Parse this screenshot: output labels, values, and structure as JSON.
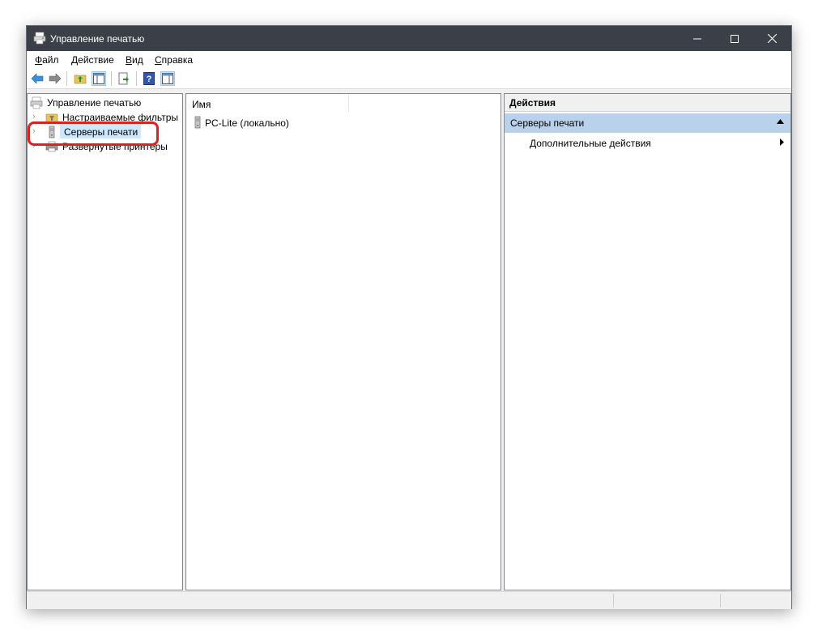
{
  "window": {
    "title": "Управление печатью"
  },
  "menu": {
    "file": {
      "key": "Ф",
      "rest": "айл"
    },
    "action": {
      "key": "Д",
      "rest": "ействие"
    },
    "view": {
      "key": "В",
      "rest": "ид"
    },
    "help": {
      "key": "С",
      "rest": "правка"
    }
  },
  "tree": {
    "root": "Управление печатью",
    "items": [
      {
        "label": "Настраиваемые фильтры",
        "icon": "folder-filter-icon"
      },
      {
        "label": "Серверы печати",
        "icon": "server-icon",
        "selected": true
      },
      {
        "label": "Развернутые принтеры",
        "icon": "printer-icon"
      }
    ]
  },
  "list": {
    "column_name": "Имя",
    "rows": [
      {
        "name": "PC-Lite (локально)",
        "icon": "server-icon"
      }
    ]
  },
  "actions": {
    "header": "Действия",
    "group": "Серверы печати",
    "items": [
      "Дополнительные действия"
    ]
  },
  "colors": {
    "titlebar": "#3b3f47",
    "selection": "#cce8ff",
    "action_group": "#b9d1ea",
    "highlight_ring": "#e02020"
  }
}
